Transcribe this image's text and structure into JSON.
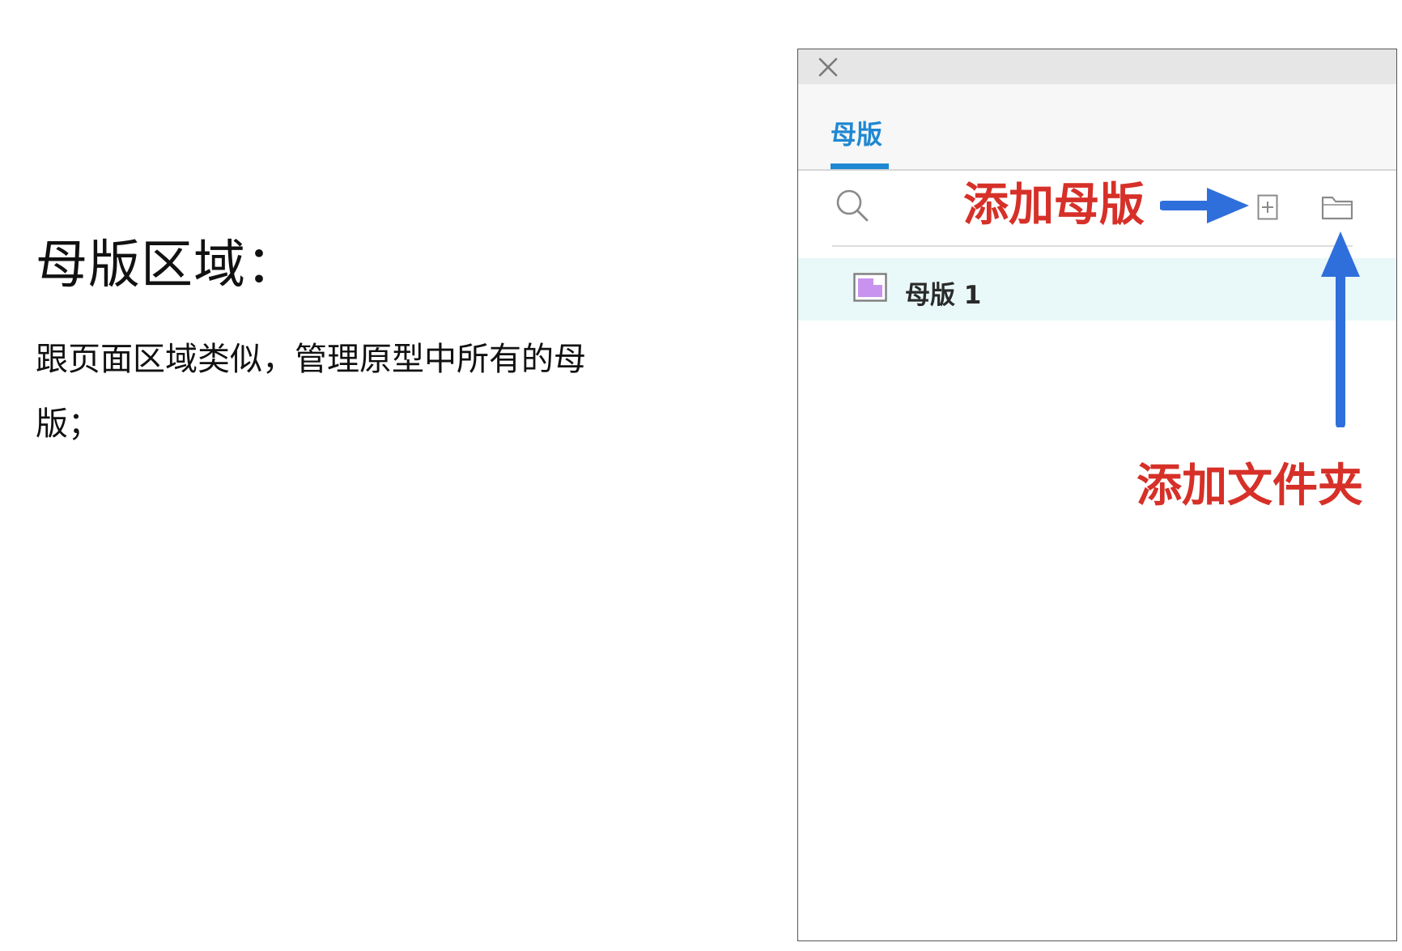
{
  "doc": {
    "title": "母版区域：",
    "description": "跟页面区域类似，管理原型中所有的母版；"
  },
  "panel": {
    "close_icon": "close-icon",
    "tab_label": "母版",
    "search_icon": "search-icon",
    "add_master_icon": "add-master-icon",
    "add_folder_icon": "folder-icon",
    "masters": [
      {
        "name": "母版 1",
        "icon": "master-page-icon"
      }
    ],
    "accent_color": "#1e88d2",
    "selected_row_color": "#e9f8f8"
  },
  "annotations": {
    "add_master": "添加母版",
    "add_folder": "添加文件夹",
    "text_color": "#d63028",
    "arrow_color": "#2f6fdb"
  }
}
